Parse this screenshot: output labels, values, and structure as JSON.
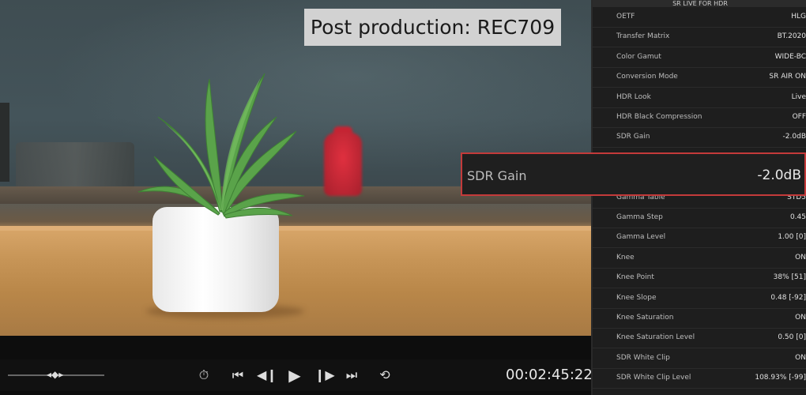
{
  "overlay": {
    "title": "Post production: REC709"
  },
  "transport": {
    "timecode": "00:02:45:22",
    "scrub_handle": "◂◆▸",
    "buttons": {
      "timer": "⏱",
      "skip_back": "⏮",
      "frame_back": "◀❙",
      "play": "▶",
      "frame_forward": "❙▶",
      "skip_forward": "⏭",
      "loop": "⟲"
    }
  },
  "panel": {
    "header": "SR LIVE FOR HDR",
    "rows": [
      {
        "label": "OETF",
        "value": "HLG"
      },
      {
        "label": "Transfer Matrix",
        "value": "BT.2020"
      },
      {
        "label": "Color Gamut",
        "value": "WIDE-BC"
      },
      {
        "label": "Conversion Mode",
        "value": "SR AIR ON"
      },
      {
        "label": "HDR Look",
        "value": "Live"
      },
      {
        "label": "HDR Black Compression",
        "value": "OFF"
      },
      {
        "label": "SDR Gain",
        "value": "-2.0dB"
      },
      {
        "label": "",
        "value": ""
      },
      {
        "label": "",
        "value": ""
      },
      {
        "label": "Gamma Table",
        "value": "STD5"
      },
      {
        "label": "Gamma Step",
        "value": "0.45"
      },
      {
        "label": "Gamma Level",
        "value": "1.00 [0]"
      },
      {
        "label": "Knee",
        "value": "ON"
      },
      {
        "label": "Knee Point",
        "value": "38% [51]"
      },
      {
        "label": "Knee Slope",
        "value": "0.48 [-92]"
      },
      {
        "label": "Knee Saturation",
        "value": "ON"
      },
      {
        "label": "Knee Saturation Level",
        "value": "0.50 [0]"
      },
      {
        "label": "SDR White Clip",
        "value": "ON"
      },
      {
        "label": "SDR White Clip Level",
        "value": "108.93% [-99]"
      }
    ]
  },
  "popup": {
    "label": "SDR Gain",
    "value": "-2.0dB"
  },
  "colors": {
    "highlight_border": "#c43a3a",
    "panel_bg": "#1e1e1e"
  }
}
